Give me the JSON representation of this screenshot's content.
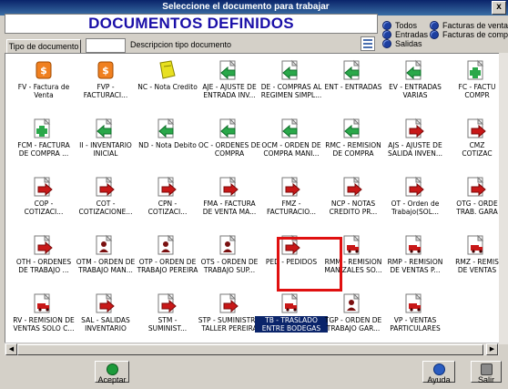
{
  "window": {
    "title": "Seleccione el documento para trabajar",
    "close_label": "x"
  },
  "banner": {
    "title": "DOCUMENTOS DEFINIDOS"
  },
  "filters": [
    {
      "label": "Todos"
    },
    {
      "label": "Facturas de venta"
    },
    {
      "label": "Entradas"
    },
    {
      "label": "Facturas de compra"
    },
    {
      "label": "Salidas"
    }
  ],
  "tipo": {
    "button_label": "Tipo de documento",
    "code_value": "",
    "description": "Descripcion tipo documento"
  },
  "documents": [
    {
      "label": "FV - Factura de\nVenta",
      "icon": "money-bag-icon"
    },
    {
      "label": "FVP -\nFACTURACI...",
      "icon": "money-bag-icon"
    },
    {
      "label": "NC - Nota Credito",
      "icon": "yellow-note-icon"
    },
    {
      "label": "AJE - AJUSTE DE\nENTRADA INV...",
      "icon": "green-arrow-left-icon"
    },
    {
      "label": "DE - COMPRAS AL\nREGIMEN SIMPL...",
      "icon": "green-arrow-left-icon"
    },
    {
      "label": "ENT - ENTRADAS",
      "icon": "green-arrow-left-icon"
    },
    {
      "label": "EV - ENTRADAS\nVARIAS",
      "icon": "green-arrow-left-icon"
    },
    {
      "label": "FC - FACTU\nCOMPR",
      "icon": "green-plus-icon"
    },
    {
      "label": "FCM - FACTURA\nDE COMPRA ...",
      "icon": "green-plus-icon"
    },
    {
      "label": "II - INVENTARIO\nINICIAL",
      "icon": "green-arrow-left-icon"
    },
    {
      "label": "ND - Nota Debito",
      "icon": "green-arrow-left-icon"
    },
    {
      "label": "OC - ORDENES DE\nCOMPRA",
      "icon": "green-arrow-left-icon"
    },
    {
      "label": "OCM - ORDEN DE\nCOMPRA MANI...",
      "icon": "green-arrow-left-icon"
    },
    {
      "label": "RMC - REMISION\nDE COMPRA",
      "icon": "green-arrow-left-icon"
    },
    {
      "label": "AJS - AJUSTE DE\nSALIDA INVEN...",
      "icon": "red-arrow-right-icon"
    },
    {
      "label": "CMZ\nCOTIZAC",
      "icon": "red-arrow-right-icon"
    },
    {
      "label": "COP -\nCOTIZACI...",
      "icon": "red-arrow-right-icon"
    },
    {
      "label": "COT -\nCOTIZACIONE...",
      "icon": "red-arrow-right-icon"
    },
    {
      "label": "CPN -\nCOTIZACI...",
      "icon": "red-arrow-right-icon"
    },
    {
      "label": "FMA - FACTURA\nDE VENTA MA...",
      "icon": "red-arrow-right-icon"
    },
    {
      "label": "FMZ -\nFACTURACIO...",
      "icon": "red-arrow-right-icon"
    },
    {
      "label": "NCP - NOTAS\nCREDITO PR...",
      "icon": "red-arrow-right-icon"
    },
    {
      "label": "OT - Orden de\nTrabajo(SOL...",
      "icon": "red-arrow-right-icon"
    },
    {
      "label": "OTG - ORDE\nTRAB. GARA",
      "icon": "red-arrow-right-icon"
    },
    {
      "label": "OTH - ORDENES\nDE TRABAJO ...",
      "icon": "red-arrow-right-icon"
    },
    {
      "label": "OTM - ORDEN DE\nTRABAJO MAN...",
      "icon": "person-icon"
    },
    {
      "label": "OTP - ORDEN DE\nTRABAJO PEREIRA",
      "icon": "person-icon"
    },
    {
      "label": "OTS - ORDEN DE\nTRABAJO SUP...",
      "icon": "person-icon"
    },
    {
      "label": "PED - PEDIDOS",
      "icon": "red-arrow-right-icon"
    },
    {
      "label": "RMM - REMISION\nMANIZALES SO...",
      "icon": "truck-icon"
    },
    {
      "label": "RMP - REMISION\nDE VENTAS P...",
      "icon": "truck-icon"
    },
    {
      "label": "RMZ - REMIS\nDE VENTAS",
      "icon": "truck-icon"
    },
    {
      "label": "RV - REMISION DE\nVENTAS SOLO C...",
      "icon": "truck-icon"
    },
    {
      "label": "SAL - SALIDAS\nINVENTARIO",
      "icon": "red-arrow-right-icon"
    },
    {
      "label": "STM -\nSUMINIST...",
      "icon": "red-arrow-right-icon"
    },
    {
      "label": "STP - SUMINISTRO\nTALLER PEREIRA",
      "icon": "red-arrow-right-icon"
    },
    {
      "label": "TB - TRASLADO\nENTRE BODEGAS",
      "icon": "truck-icon",
      "selected": true
    },
    {
      "label": "TGP - ORDEN DE\nTRABAJO GAR...",
      "icon": "person-icon"
    },
    {
      "label": "VP - VENTAS\nPARTICULARES",
      "icon": "truck-icon"
    }
  ],
  "buttons": {
    "accept": "Aceptar",
    "help": "Ayuda",
    "exit": "Salir"
  },
  "colors": {
    "banner_text": "#1a0fa8",
    "selection": "#0a246a",
    "highlight_frame": "#e01010"
  }
}
